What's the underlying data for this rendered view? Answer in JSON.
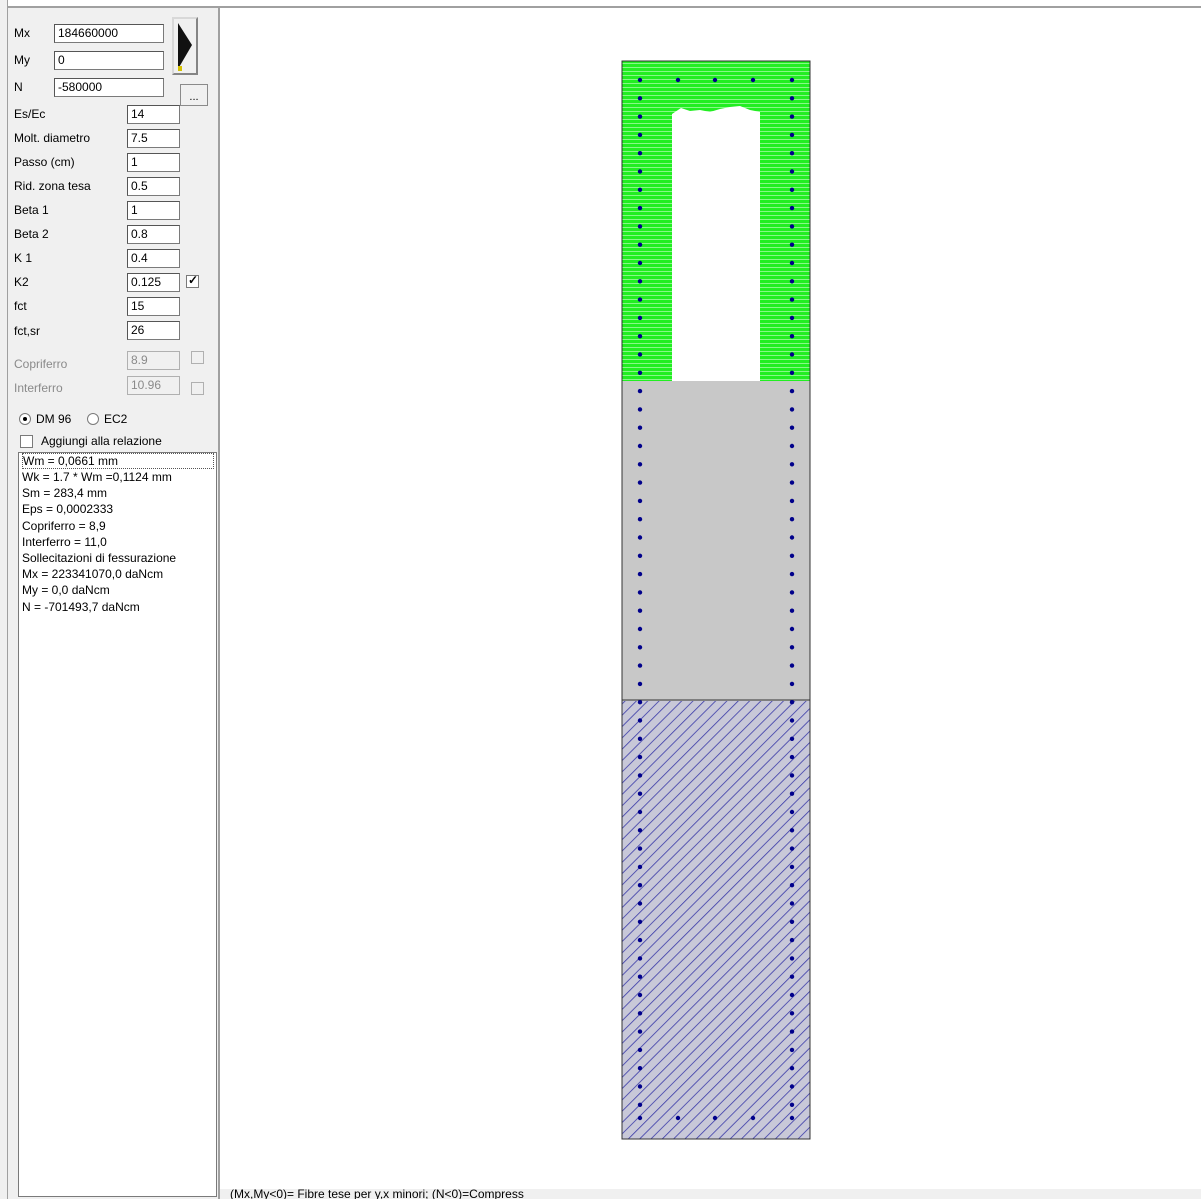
{
  "inputs": {
    "mx": {
      "label": "Mx",
      "value": "184660000"
    },
    "my": {
      "label": "My",
      "value": "0"
    },
    "n": {
      "label": "N",
      "value": "-580000"
    },
    "more_button": "..."
  },
  "params": [
    {
      "label": "Es/Ec",
      "value": "14"
    },
    {
      "label": "Molt. diametro",
      "value": "7.5"
    },
    {
      "label": "Passo (cm)",
      "value": "1"
    },
    {
      "label": "Rid. zona tesa",
      "value": "0.5"
    },
    {
      "label": "Beta 1",
      "value": "1"
    },
    {
      "label": "Beta 2",
      "value": "0.8"
    },
    {
      "label": "K 1",
      "value": "0.4"
    },
    {
      "label": "K2",
      "value": "0.125"
    },
    {
      "label": "fct",
      "value": "15"
    },
    {
      "label": "fct,sr",
      "value": "26"
    },
    {
      "label": "Copriferro",
      "value": "8.9"
    },
    {
      "label": "Interferro",
      "value": "10.96"
    }
  ],
  "k2_checked": true,
  "copriferro_checked": false,
  "interferro_checked": false,
  "norm_options": [
    {
      "label": "DM 96",
      "selected": true
    },
    {
      "label": "EC2",
      "selected": false
    }
  ],
  "add_to_report": {
    "label": "Aggiungi alla relazione",
    "checked": false
  },
  "results": [
    "Wm = 0,0661 mm",
    "Wk = 1.7 * Wm =0,1124 mm",
    "Sm = 283,4 mm",
    "Eps = 0,0002333",
    "Copriferro = 8,9",
    "Interferro = 11,0",
    "Sollecitazioni di fessurazione",
    "Mx = 223341070,0 daNcm",
    "My = 0,0 daNcm",
    "N = -701493,7 daNcm"
  ],
  "status_text": "(Mx,My<0)= Fibre tese per y,x minori; (N<0)=Compress",
  "colors": {
    "compressed_zone": "#22ee22",
    "section_gray": "#c8c8c8",
    "tension_hatch": "#4a4ab0",
    "rebar": "#00008b"
  }
}
